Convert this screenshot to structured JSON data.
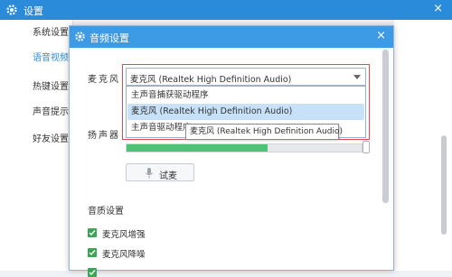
{
  "window": {
    "title": "设置",
    "close": "×"
  },
  "sidebar": {
    "items": [
      {
        "label": "系统设置"
      },
      {
        "label": "语音视频"
      },
      {
        "label": "热键设置"
      },
      {
        "label": "声音提示"
      },
      {
        "label": "好友设置"
      }
    ]
  },
  "dialog": {
    "title": "音频设置",
    "close": "×",
    "mic_label": "麦克风",
    "mic_value": "麦克风 (Realtek High Definition Audio)",
    "mic_options": [
      "主声音捕获驱动程序",
      "麦克风 (Realtek High Definition Audio)",
      "主声音驱动程序"
    ],
    "tooltip": "麦克风 (Realtek High Definition Audio)",
    "speaker_label": "扬声器",
    "test_button": "试麦",
    "level_fraction": 0.6,
    "quality_section": "音质设置",
    "checkboxes": [
      {
        "label": "麦克风增强",
        "checked": true
      },
      {
        "label": "麦克风降噪",
        "checked": true
      }
    ]
  },
  "colors": {
    "titlebar": "#2b8bdb",
    "dialog_titlebar": "#3d9be6",
    "highlight": "#c7e2f8",
    "level": "#4fc278",
    "checkbox": "#3aa552",
    "annotation": "#e14a4a"
  }
}
